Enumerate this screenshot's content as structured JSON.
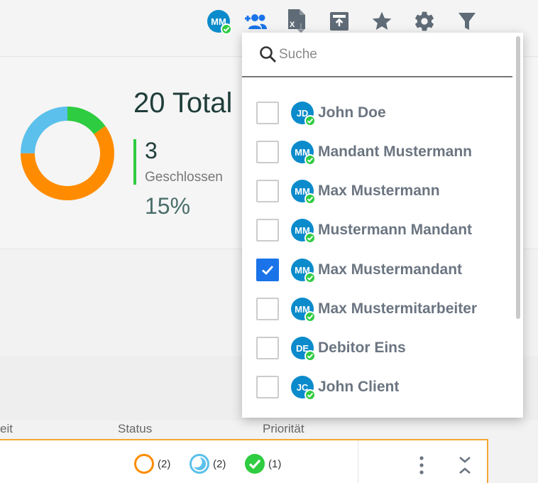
{
  "toolbar": {
    "user_avatar_initials": "MM",
    "icons": [
      "add-users-icon",
      "excel-export-icon",
      "archive-upload-icon",
      "star-icon",
      "gear-icon",
      "filter-icon"
    ]
  },
  "stats": {
    "total": "20 Total",
    "closed_count": "3",
    "closed_label": "Geschlossen",
    "closed_percent": "15%"
  },
  "donut": {
    "segments": [
      {
        "name": "closed",
        "fraction": 0.15,
        "color": "#2ecc40"
      },
      {
        "name": "open",
        "fraction": 0.6,
        "color": "#ff8c00"
      },
      {
        "name": "in-progress",
        "fraction": 0.25,
        "color": "#5bc0eb"
      }
    ]
  },
  "table": {
    "headers": [
      "eit",
      "Status",
      "Priorität"
    ],
    "row": {
      "status_counts": [
        "(2)",
        "(2)",
        "(1)"
      ]
    }
  },
  "dropdown": {
    "search_placeholder": "Suche",
    "items": [
      {
        "initials": "JD",
        "name": "John Doe",
        "checked": false
      },
      {
        "initials": "MM",
        "name": "Mandant Mustermann",
        "checked": false
      },
      {
        "initials": "MM",
        "name": "Max Mustermann",
        "checked": false
      },
      {
        "initials": "MM",
        "name": "Mustermann Mandant",
        "checked": false
      },
      {
        "initials": "MM",
        "name": "Max Mustermandant",
        "checked": true
      },
      {
        "initials": "MM",
        "name": "Max Mustermitarbeiter",
        "checked": false
      },
      {
        "initials": "DE",
        "name": "Debitor Eins",
        "checked": false
      },
      {
        "initials": "JC",
        "name": "John Client",
        "checked": false
      }
    ]
  },
  "colors": {
    "accent_blue": "#0b8bcb",
    "check_green": "#2ecc40",
    "orange": "#ff8c00",
    "light_blue": "#5bc0eb",
    "row_border": "#f5a733"
  }
}
